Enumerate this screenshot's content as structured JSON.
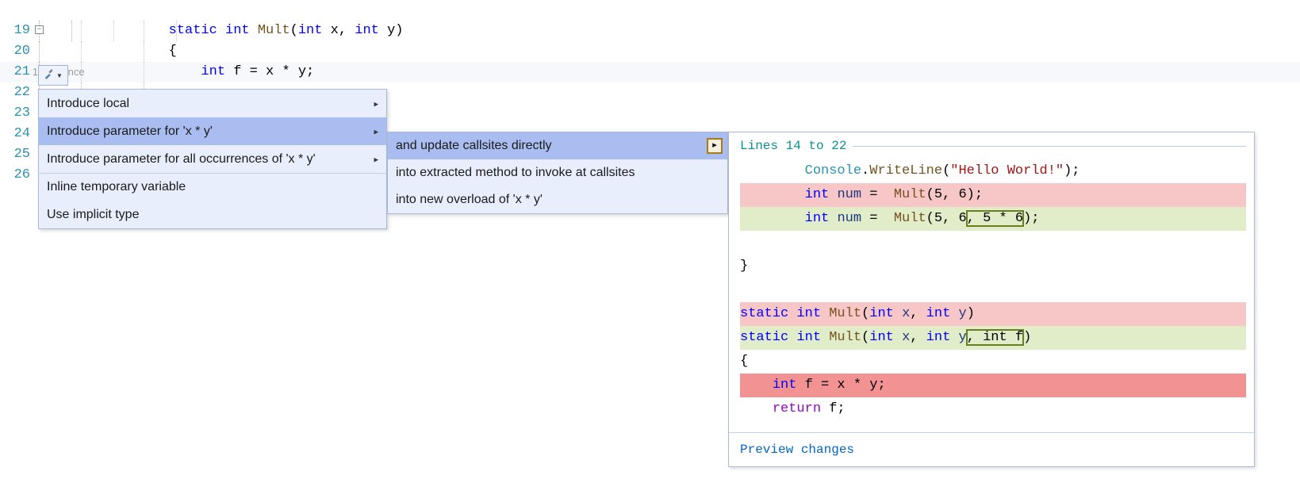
{
  "editor": {
    "codelens": "1 reference",
    "lines": [
      {
        "num": 19,
        "tokens": [
          {
            "t": "static ",
            "c": "kw"
          },
          {
            "t": "int ",
            "c": "type"
          },
          {
            "t": "Mult",
            "c": "method"
          },
          {
            "t": "(",
            "c": "punct"
          },
          {
            "t": "int ",
            "c": "type"
          },
          {
            "t": "x",
            "c": "ident"
          },
          {
            "t": ", ",
            "c": "punct"
          },
          {
            "t": "int ",
            "c": "type"
          },
          {
            "t": "y",
            "c": "ident"
          },
          {
            "t": ")",
            "c": "punct"
          }
        ]
      },
      {
        "num": 20,
        "tokens": [
          {
            "t": "{",
            "c": "punct"
          }
        ]
      },
      {
        "num": 21,
        "current": true,
        "indent": 1,
        "tokens": [
          {
            "t": "int ",
            "c": "type"
          },
          {
            "t": "f ",
            "c": "ident"
          },
          {
            "t": "= x * y;",
            "c": "op"
          }
        ]
      },
      {
        "num": 22
      },
      {
        "num": 23
      },
      {
        "num": 24
      },
      {
        "num": 25
      },
      {
        "num": 26
      }
    ]
  },
  "menu1": {
    "items": [
      {
        "label": "Introduce local",
        "sub": true
      },
      {
        "label": "Introduce parameter for 'x * y'",
        "sub": true,
        "hover": true
      },
      {
        "label": "Introduce parameter for all occurrences of 'x * y'",
        "sub": true
      },
      {
        "label": "Inline temporary variable",
        "sep": true
      },
      {
        "label": "Use implicit type"
      }
    ]
  },
  "menu2": {
    "items": [
      {
        "label": "and update callsites directly",
        "hover": true
      },
      {
        "label": "into extracted method to invoke at callsites"
      },
      {
        "label": "into new overload of 'x * y'"
      }
    ]
  },
  "preview": {
    "header": "Lines 14 to 22",
    "lines": [
      {
        "indent": 2,
        "spans": [
          {
            "t": "Console",
            "c": "p-type"
          },
          {
            "t": "."
          },
          {
            "t": "WriteLine",
            "c": "p-method"
          },
          {
            "t": "("
          },
          {
            "t": "\"Hello World!\"",
            "c": "p-str"
          },
          {
            "t": ");"
          }
        ]
      },
      {
        "bg": "del",
        "indent": 2,
        "spans": [
          {
            "t": "int ",
            "c": "p-kw"
          },
          {
            "t": "num",
            "c": "p-ident"
          },
          {
            "t": " =  "
          },
          {
            "t": "Mult",
            "c": "p-method"
          },
          {
            "t": "(5, 6);"
          }
        ]
      },
      {
        "bg": "add",
        "indent": 2,
        "spans": [
          {
            "t": "int ",
            "c": "p-kw"
          },
          {
            "t": "num",
            "c": "p-ident"
          },
          {
            "t": " =  "
          },
          {
            "t": "Mult",
            "c": "p-method"
          },
          {
            "t": "(5, 6"
          },
          {
            "t": ", 5 * 6",
            "hl": true
          },
          {
            "t": ");"
          }
        ]
      },
      {
        "spans": [
          {
            "t": " "
          }
        ]
      },
      {
        "spans": [
          {
            "t": "}"
          }
        ]
      },
      {
        "spans": [
          {
            "t": " "
          }
        ]
      },
      {
        "bg": "del",
        "spans": [
          {
            "t": "static ",
            "c": "p-kw"
          },
          {
            "t": "int ",
            "c": "p-kw"
          },
          {
            "t": "Mult",
            "c": "p-method"
          },
          {
            "t": "("
          },
          {
            "t": "int ",
            "c": "p-kw"
          },
          {
            "t": "x",
            "c": "p-ident"
          },
          {
            "t": ", "
          },
          {
            "t": "int ",
            "c": "p-kw"
          },
          {
            "t": "y",
            "c": "p-ident"
          },
          {
            "t": ")"
          }
        ]
      },
      {
        "bg": "add",
        "spans": [
          {
            "t": "static ",
            "c": "p-kw"
          },
          {
            "t": "int ",
            "c": "p-kw"
          },
          {
            "t": "Mult",
            "c": "p-method"
          },
          {
            "t": "("
          },
          {
            "t": "int ",
            "c": "p-kw"
          },
          {
            "t": "x",
            "c": "p-ident"
          },
          {
            "t": ", "
          },
          {
            "t": "int ",
            "c": "p-kw"
          },
          {
            "t": "y",
            "c": "p-ident"
          },
          {
            "t": ", int f",
            "hl": true
          },
          {
            "t": ")"
          }
        ]
      },
      {
        "spans": [
          {
            "t": "{"
          }
        ]
      },
      {
        "bg": "del-strong",
        "indent": 1,
        "spans": [
          {
            "t": "int ",
            "c": "p-kw"
          },
          {
            "t": "f = x * y;"
          }
        ]
      },
      {
        "indent": 1,
        "spans": [
          {
            "t": "return",
            "c": "p-return"
          },
          {
            "t": " f;"
          }
        ]
      }
    ],
    "footer_link": "Preview changes"
  }
}
